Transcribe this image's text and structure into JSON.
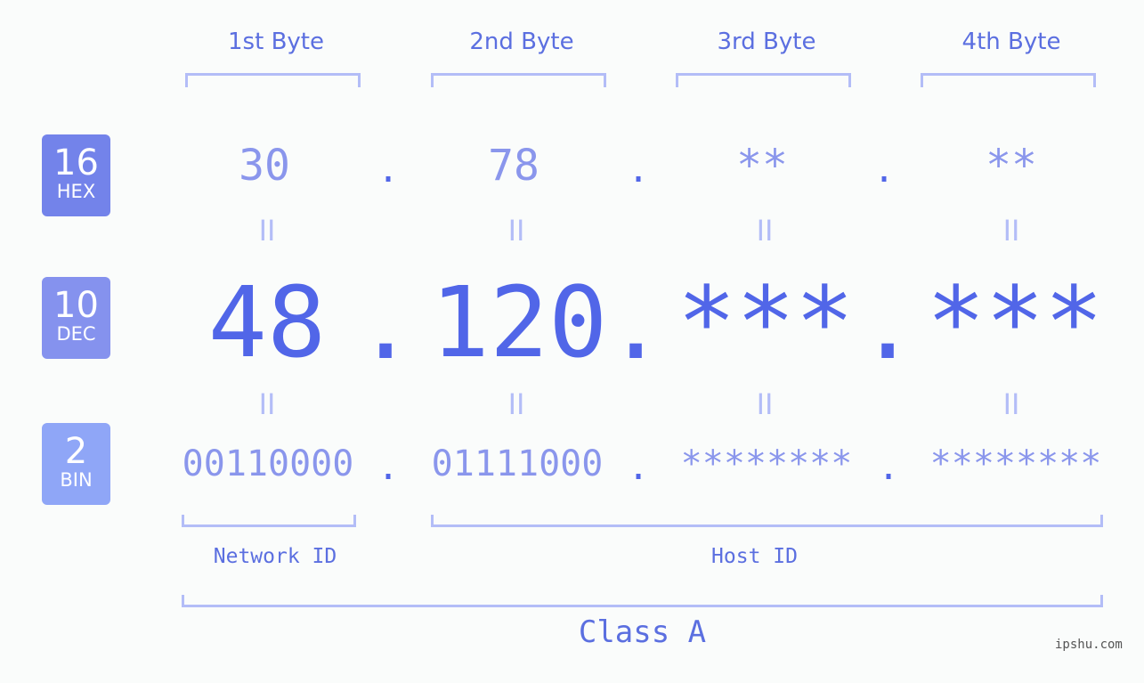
{
  "badges": [
    {
      "num": "16",
      "label": "HEX",
      "color": "#7383ea"
    },
    {
      "num": "10",
      "label": "DEC",
      "color": "#8592ee"
    },
    {
      "num": "2",
      "label": "BIN",
      "color": "#8fa6f7"
    }
  ],
  "byte_headers": [
    "1st Byte",
    "2nd Byte",
    "3rd Byte",
    "4th Byte"
  ],
  "hex": [
    "30",
    "78",
    "**",
    "**"
  ],
  "dec": [
    "48",
    "120",
    "***",
    "***"
  ],
  "bin": [
    "00110000",
    "01111000",
    "********",
    "********"
  ],
  "separator": ".",
  "equals": "II",
  "network_label": "Network ID",
  "host_label": "Host ID",
  "class_label": "Class A",
  "watermark": "ipshu.com"
}
